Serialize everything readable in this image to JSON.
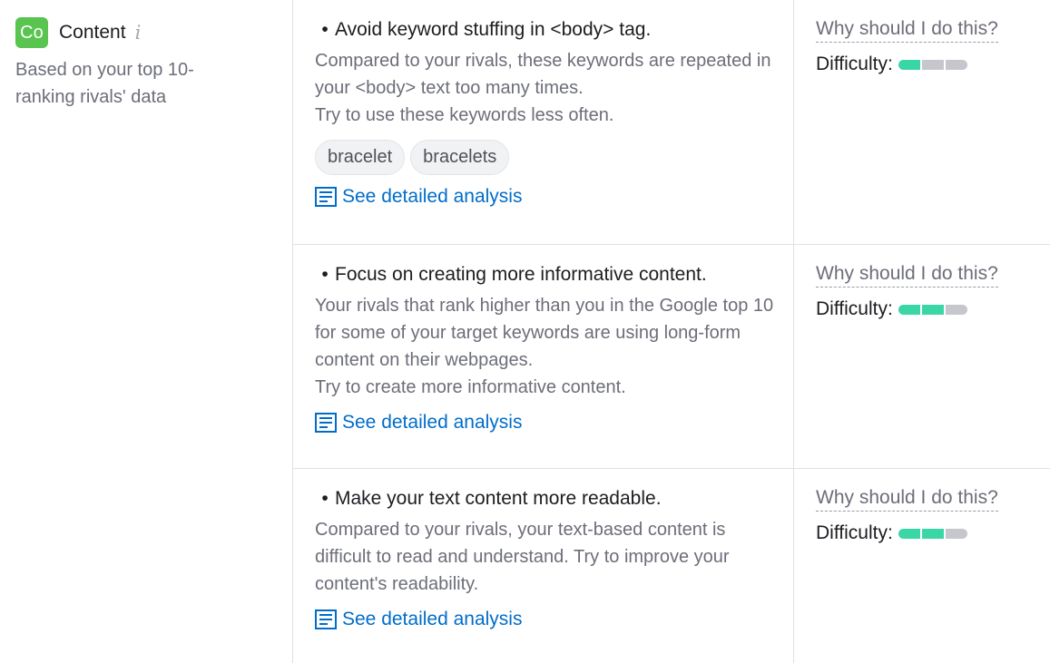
{
  "category": {
    "badge": "Co",
    "title": "Content",
    "info_icon": "info-icon",
    "subtitle": "Based on your top 10-ranking rivals' data",
    "badge_color": "#59c44f"
  },
  "colors": {
    "link": "#006dca",
    "difficulty_filled": "#3ad6a6",
    "difficulty_empty": "#c5c7cd"
  },
  "issues": [
    {
      "title": "Avoid keyword stuffing in <body> tag.",
      "description": [
        "Compared to your rivals, these keywords are repeated in your <body> text too many times.",
        "Try to use these keywords less often."
      ],
      "keywords": [
        "bracelet",
        "bracelets"
      ],
      "link": "See detailed analysis",
      "why": "Why should I do this?",
      "difficulty_label": "Difficulty:",
      "difficulty_level": 1,
      "difficulty_max": 3
    },
    {
      "title": "Focus on creating more informative content.",
      "description": [
        "Your rivals that rank higher than you in the Google top 10 for some of your target keywords are using long-form content on their webpages.",
        "Try to create more informative content."
      ],
      "link": "See detailed analysis",
      "why": "Why should I do this?",
      "difficulty_label": "Difficulty:",
      "difficulty_level": 2,
      "difficulty_max": 3
    },
    {
      "title": "Make your text content more readable.",
      "description": [
        "Compared to your rivals, your text-based content is difficult to read and understand. Try to improve your content's readability."
      ],
      "link": "See detailed analysis",
      "why": "Why should I do this?",
      "difficulty_label": "Difficulty:",
      "difficulty_level": 2,
      "difficulty_max": 3
    }
  ]
}
